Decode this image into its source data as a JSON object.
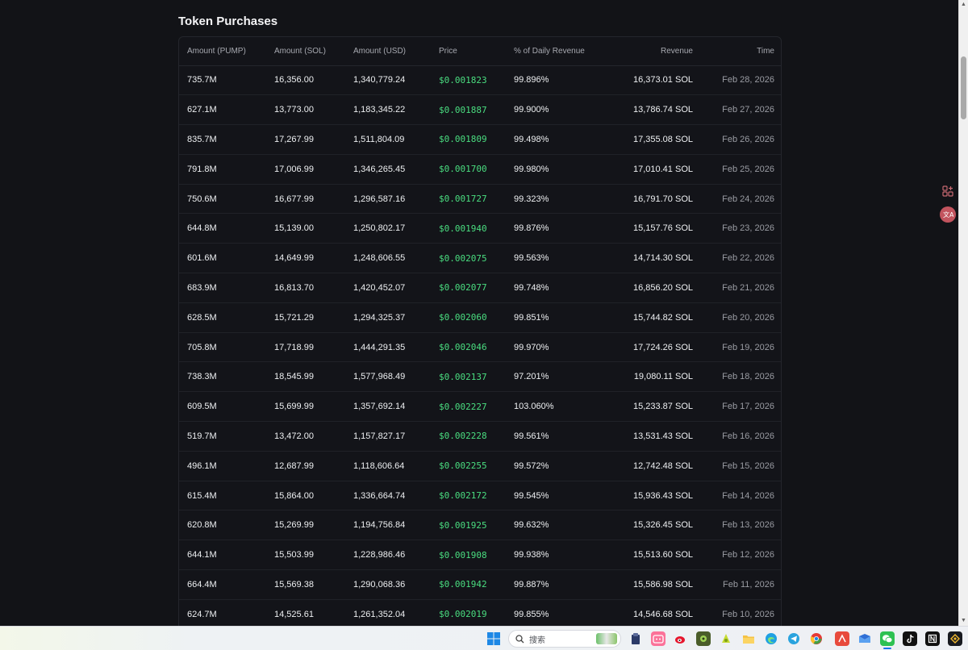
{
  "section": {
    "title": "Token Purchases"
  },
  "table": {
    "headers": {
      "amount_pump": "Amount (PUMP)",
      "amount_sol": "Amount (SOL)",
      "amount_usd": "Amount (USD)",
      "price": "Price",
      "pct": "% of Daily Revenue",
      "revenue": "Revenue",
      "time": "Time"
    },
    "rows": [
      [
        "735.7M",
        "16,356.00",
        "1,340,779.24",
        "$0.001823",
        "99.896%",
        "16,373.01 SOL",
        "Feb 28, 2026"
      ],
      [
        "627.1M",
        "13,773.00",
        "1,183,345.22",
        "$0.001887",
        "99.900%",
        "13,786.74 SOL",
        "Feb 27, 2026"
      ],
      [
        "835.7M",
        "17,267.99",
        "1,511,804.09",
        "$0.001809",
        "99.498%",
        "17,355.08 SOL",
        "Feb 26, 2026"
      ],
      [
        "791.8M",
        "17,006.99",
        "1,346,265.45",
        "$0.001700",
        "99.980%",
        "17,010.41 SOL",
        "Feb 25, 2026"
      ],
      [
        "750.6M",
        "16,677.99",
        "1,296,587.16",
        "$0.001727",
        "99.323%",
        "16,791.70 SOL",
        "Feb 24, 2026"
      ],
      [
        "644.8M",
        "15,139.00",
        "1,250,802.17",
        "$0.001940",
        "99.876%",
        "15,157.76 SOL",
        "Feb 23, 2026"
      ],
      [
        "601.6M",
        "14,649.99",
        "1,248,606.55",
        "$0.002075",
        "99.563%",
        "14,714.30 SOL",
        "Feb 22, 2026"
      ],
      [
        "683.9M",
        "16,813.70",
        "1,420,452.07",
        "$0.002077",
        "99.748%",
        "16,856.20 SOL",
        "Feb 21, 2026"
      ],
      [
        "628.5M",
        "15,721.29",
        "1,294,325.37",
        "$0.002060",
        "99.851%",
        "15,744.82 SOL",
        "Feb 20, 2026"
      ],
      [
        "705.8M",
        "17,718.99",
        "1,444,291.35",
        "$0.002046",
        "99.970%",
        "17,724.26 SOL",
        "Feb 19, 2026"
      ],
      [
        "738.3M",
        "18,545.99",
        "1,577,968.49",
        "$0.002137",
        "97.201%",
        "19,080.11 SOL",
        "Feb 18, 2026"
      ],
      [
        "609.5M",
        "15,699.99",
        "1,357,692.14",
        "$0.002227",
        "103.060%",
        "15,233.87 SOL",
        "Feb 17, 2026"
      ],
      [
        "519.7M",
        "13,472.00",
        "1,157,827.17",
        "$0.002228",
        "99.561%",
        "13,531.43 SOL",
        "Feb 16, 2026"
      ],
      [
        "496.1M",
        "12,687.99",
        "1,118,606.64",
        "$0.002255",
        "99.572%",
        "12,742.48 SOL",
        "Feb 15, 2026"
      ],
      [
        "615.4M",
        "15,864.00",
        "1,336,664.74",
        "$0.002172",
        "99.545%",
        "15,936.43 SOL",
        "Feb 14, 2026"
      ],
      [
        "620.8M",
        "15,269.99",
        "1,194,756.84",
        "$0.001925",
        "99.632%",
        "15,326.45 SOL",
        "Feb 13, 2026"
      ],
      [
        "644.1M",
        "15,503.99",
        "1,228,986.46",
        "$0.001908",
        "99.938%",
        "15,513.60 SOL",
        "Feb 12, 2026"
      ],
      [
        "664.4M",
        "15,569.38",
        "1,290,068.36",
        "$0.001942",
        "99.887%",
        "15,586.98 SOL",
        "Feb 11, 2026"
      ],
      [
        "624.7M",
        "14,525.61",
        "1,261,352.04",
        "$0.002019",
        "99.855%",
        "14,546.68 SOL",
        "Feb 10, 2026"
      ]
    ]
  },
  "taskbar": {
    "search_placeholder": "搜索",
    "icons": [
      "windows-start-icon",
      "search-icon",
      "clipboard-app-icon",
      "bilibili-icon",
      "weibo-icon",
      "game-icon",
      "lime-app-icon",
      "file-explorer-icon",
      "edge-browser-icon",
      "telegram-icon",
      "chrome-icon",
      "red-app-icon",
      "mail-app-icon",
      "wechat-icon",
      "tiktok-icon",
      "notion-icon",
      "binance-icon"
    ]
  },
  "colors": {
    "background": "#121317",
    "price_green": "#4ade80",
    "muted_text": "#9a9ca3"
  }
}
